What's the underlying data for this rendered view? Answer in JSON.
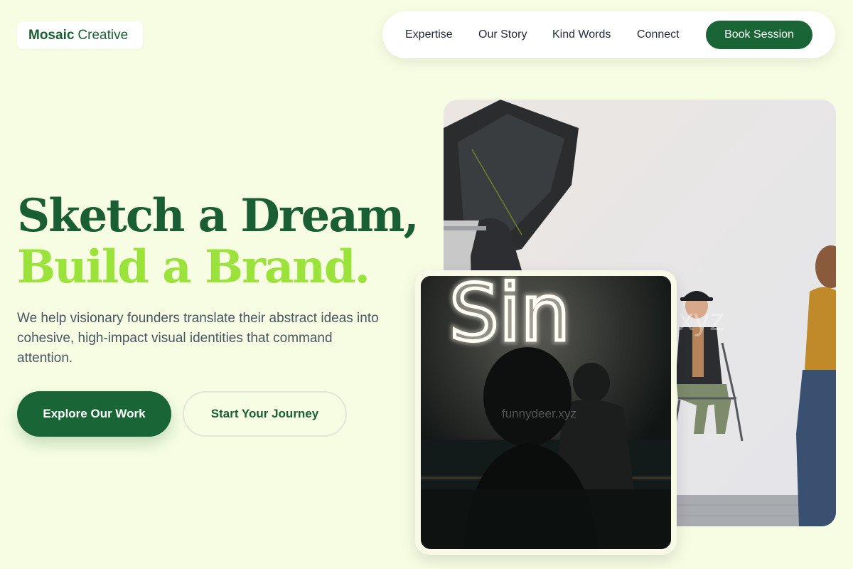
{
  "brand": {
    "name_bold": "Mosaic",
    "name_light": "Creative"
  },
  "nav": {
    "links": [
      "Expertise",
      "Our Story",
      "Kind Words",
      "Connect"
    ],
    "cta_label": "Book Session"
  },
  "hero": {
    "headline_line1": "Sketch a Dream,",
    "headline_line2": "Build a Brand.",
    "subtext": "We help visionary founders translate their abstract ideas into cohesive, high-impact visual identities that command attention.",
    "primary_cta": "Explore Our Work",
    "secondary_cta": "Start Your Journey"
  },
  "images": {
    "studio": {
      "watermark": "xyz"
    },
    "neon": {
      "sign_text": "Sin",
      "watermark": "funnydeer.xyz"
    }
  },
  "colors": {
    "background": "#f6fde3",
    "brand_green": "#1a6535",
    "accent_lime": "#9be33a",
    "body_text": "#4b5563"
  }
}
